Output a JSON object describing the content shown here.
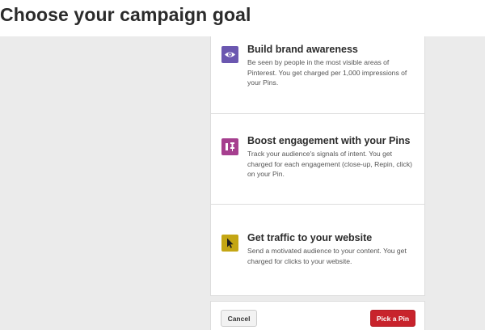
{
  "header": {
    "title": "Choose your campaign goal"
  },
  "goals": [
    {
      "title": "Build brand awareness",
      "description": "Be seen by people in the most visible areas of Pinterest. You get charged per 1,000 impressions of your Pins.",
      "icon": "eye-icon",
      "icon_color": "#6b57b0"
    },
    {
      "title": "Boost engagement with your Pins",
      "description": "Track your audience's signals of intent. You get charged for each engagement (close-up, Repin, click) on your Pin.",
      "icon": "pushpin-icon",
      "icon_color": "#a63f8f"
    },
    {
      "title": "Get traffic to your website",
      "description": "Send a motivated audience to your content. You get charged for clicks to your website.",
      "icon": "cursor-icon",
      "icon_color": "#c4a614"
    }
  ],
  "footer": {
    "cancel_label": "Cancel",
    "pick_label": "Pick a Pin"
  },
  "colors": {
    "primary": "#c8232c",
    "background": "#ebebeb"
  }
}
